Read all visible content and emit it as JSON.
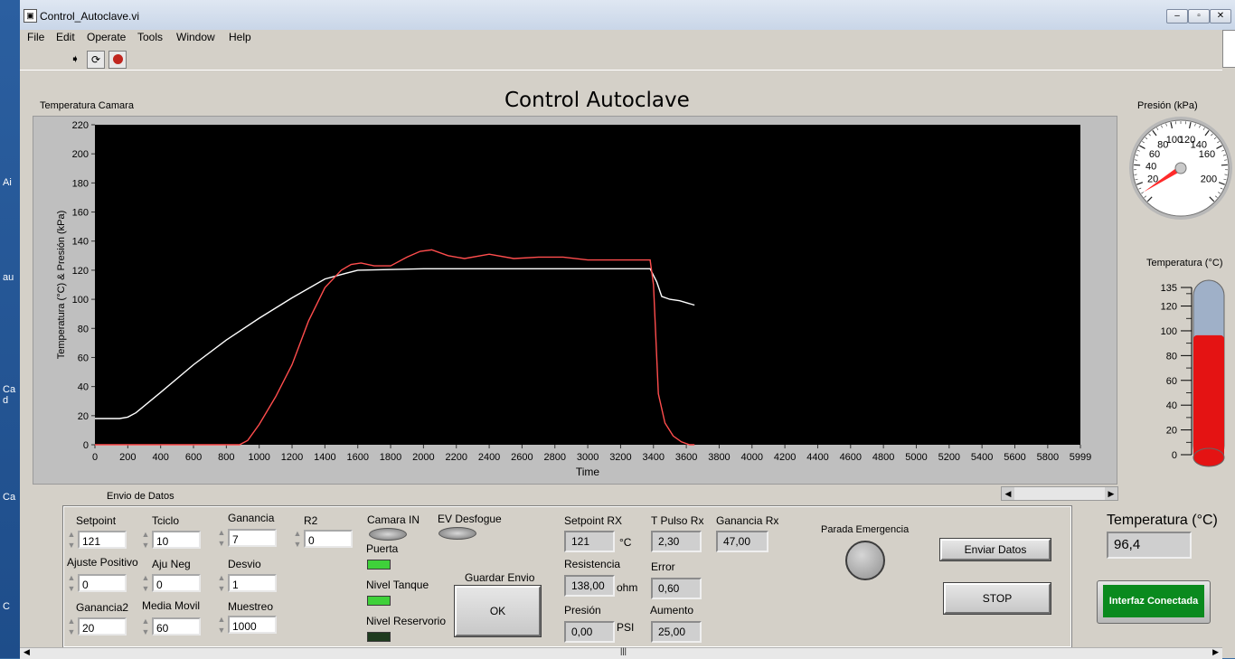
{
  "window": {
    "title": "Control_Autoclave.vi",
    "desktop_labels": [
      "Ai",
      "au",
      "Ca\nd",
      "Ca",
      "C"
    ]
  },
  "menu": [
    "File",
    "Edit",
    "Operate",
    "Tools",
    "Window",
    "Help"
  ],
  "panel": {
    "title": "Control Autoclave"
  },
  "chart_data": {
    "type": "line",
    "title": "Temperatura Camara",
    "xlabel": "Time",
    "ylabel": "Temperatura (°C) & Presión (kPa)",
    "xlim": [
      0,
      5999
    ],
    "ylim": [
      0,
      220
    ],
    "xticks": [
      "0",
      "200",
      "400",
      "600",
      "800",
      "1000",
      "1200",
      "1400",
      "1600",
      "1800",
      "2000",
      "2200",
      "2400",
      "2600",
      "2800",
      "3000",
      "3200",
      "3400",
      "3600",
      "3800",
      "4000",
      "4200",
      "4400",
      "4600",
      "4800",
      "5000",
      "5200",
      "5400",
      "5600",
      "5800",
      "5999"
    ],
    "yticks": [
      "0",
      "20",
      "40",
      "60",
      "80",
      "100",
      "120",
      "140",
      "160",
      "180",
      "200",
      "220"
    ],
    "series": [
      {
        "color": "#ffffff",
        "x": [
          0,
          150,
          200,
          250,
          400,
          600,
          800,
          1000,
          1200,
          1400,
          1500,
          1600,
          2000,
          2400,
          2800,
          3200,
          3380,
          3420,
          3450,
          3500,
          3560,
          3650
        ],
        "y": [
          18,
          18,
          19,
          22,
          36,
          55,
          72,
          87,
          101,
          114,
          117,
          120,
          121,
          121,
          121,
          121,
          121,
          112,
          102,
          100,
          99,
          96
        ]
      },
      {
        "color": "#ff4d4d",
        "x": [
          0,
          880,
          930,
          1000,
          1100,
          1200,
          1300,
          1400,
          1500,
          1560,
          1620,
          1700,
          1800,
          1900,
          1980,
          2050,
          2150,
          2250,
          2400,
          2550,
          2700,
          2850,
          3000,
          3200,
          3380,
          3400,
          3430,
          3470,
          3520,
          3570,
          3620,
          3650
        ],
        "y": [
          0,
          0,
          3,
          14,
          33,
          55,
          85,
          108,
          120,
          124,
          125,
          123,
          123,
          129,
          133,
          134,
          130,
          128,
          131,
          128,
          129,
          129,
          127,
          127,
          127,
          110,
          35,
          15,
          6,
          2,
          0,
          0
        ]
      }
    ]
  },
  "gauge": {
    "label": "Presión (kPa)",
    "ticks": [
      "20",
      "40",
      "60",
      "80",
      "100",
      "120",
      "140",
      "160",
      "200"
    ],
    "value": 10,
    "color": "#ff2a2a"
  },
  "thermometer": {
    "label": "Temperatura (°C)",
    "ticks": [
      "0",
      "20",
      "40",
      "60",
      "80",
      "100",
      "120",
      "135"
    ],
    "value": 96.4,
    "max": 135,
    "fill": "#e41313",
    "empty": "#9fb0c8"
  },
  "temp_display": {
    "label": "Temperatura (°C)",
    "value": "96,4"
  },
  "section": {
    "title": "Envio de Datos"
  },
  "controls": {
    "setpoint": {
      "label": "Setpoint",
      "value": "121"
    },
    "tciclo": {
      "label": "Tciclo",
      "value": "10"
    },
    "ganancia": {
      "label": "Ganancia",
      "value": "7"
    },
    "r2": {
      "label": "R2",
      "value": "0"
    },
    "ajuste_positivo": {
      "label": "Ajuste Positivo",
      "value": "0"
    },
    "aju_neg": {
      "label": "Aju Neg",
      "value": "0"
    },
    "desvio": {
      "label": "Desvio",
      "value": "1"
    },
    "ganancia2": {
      "label": "Ganancia2",
      "value": "20"
    },
    "media_movil": {
      "label": "Media Movil",
      "value": "60"
    },
    "muestreo": {
      "label": "Muestreo",
      "value": "1000"
    }
  },
  "leds": {
    "camara_in": {
      "label": "Camara IN"
    },
    "ev_desfogue": {
      "label": "EV Desfogue"
    },
    "puerta": {
      "label": "Puerta",
      "color": "#3fd13a"
    },
    "nivel_tanque": {
      "label": "Nivel Tanque",
      "color": "#3fd13a"
    },
    "nivel_reservorio": {
      "label": "Nivel Reservorio",
      "color": "#1f3b1f"
    }
  },
  "guardar": {
    "label": "Guardar Envio",
    "button": "OK"
  },
  "indicators": {
    "setpoint_rx": {
      "label": "Setpoint RX",
      "value": "121",
      "unit": "°C"
    },
    "t_pulso_rx": {
      "label": "T Pulso Rx",
      "value": "2,30"
    },
    "ganancia_rx": {
      "label": "Ganancia Rx",
      "value": "47,00"
    },
    "resistencia": {
      "label": "Resistencia",
      "value": "138,00",
      "unit": "ohm"
    },
    "error": {
      "label": "Error",
      "value": "0,60"
    },
    "presion": {
      "label": "Presión",
      "value": "0,00",
      "unit": "PSI"
    },
    "aumento": {
      "label": "Aumento",
      "value": "25,00"
    }
  },
  "emergency": {
    "label": "Parada Emergencia"
  },
  "buttons": {
    "enviar": "Enviar Datos",
    "stop": "STOP",
    "interfaz": "Interfaz Conectada",
    "interfaz_color": "#0a8a1e"
  }
}
